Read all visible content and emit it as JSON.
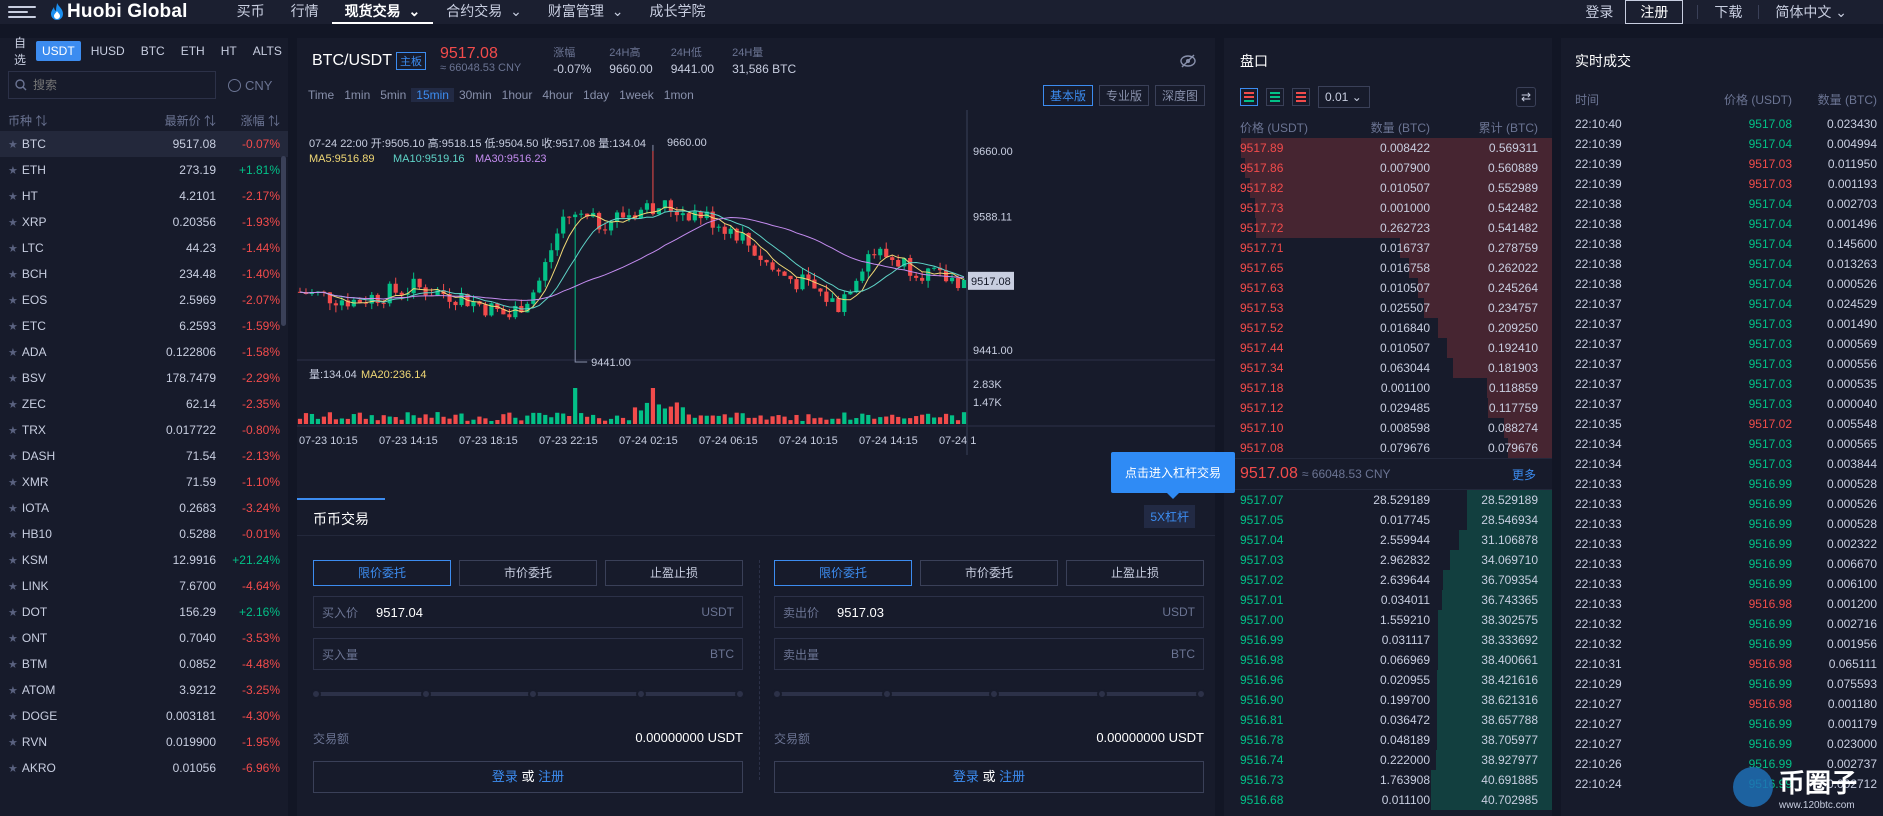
{
  "header": {
    "logo": "Huobi Global",
    "nav": [
      "买币",
      "行情",
      "现货交易",
      "合约交易",
      "财富管理",
      "成长学院"
    ],
    "nav_dropdown": [
      false,
      false,
      true,
      true,
      true,
      false
    ],
    "active_nav": 2,
    "login": "登录",
    "register": "注册",
    "download": "下载",
    "language": "简体中文"
  },
  "left": {
    "tabs": [
      "自选",
      "USDT",
      "HUSD",
      "BTC",
      "ETH",
      "HT",
      "ALTS"
    ],
    "active_tab": 1,
    "search_placeholder": "搜索",
    "currency_toggle": "CNY",
    "columns": [
      "币种",
      "最新价",
      "涨幅"
    ],
    "rows": [
      {
        "sym": "BTC",
        "price": "9517.08",
        "chg": "-0.07%"
      },
      {
        "sym": "ETH",
        "price": "273.19",
        "chg": "+1.81%"
      },
      {
        "sym": "HT",
        "price": "4.2101",
        "chg": "-2.17%"
      },
      {
        "sym": "XRP",
        "price": "0.20356",
        "chg": "-1.93%"
      },
      {
        "sym": "LTC",
        "price": "44.23",
        "chg": "-1.44%"
      },
      {
        "sym": "BCH",
        "price": "234.48",
        "chg": "-1.40%"
      },
      {
        "sym": "EOS",
        "price": "2.5969",
        "chg": "-2.07%"
      },
      {
        "sym": "ETC",
        "price": "6.2593",
        "chg": "-1.59%"
      },
      {
        "sym": "ADA",
        "price": "0.122806",
        "chg": "-1.58%"
      },
      {
        "sym": "BSV",
        "price": "178.7479",
        "chg": "-2.29%"
      },
      {
        "sym": "ZEC",
        "price": "62.14",
        "chg": "-2.35%"
      },
      {
        "sym": "TRX",
        "price": "0.017722",
        "chg": "-0.80%"
      },
      {
        "sym": "DASH",
        "price": "71.54",
        "chg": "-2.13%"
      },
      {
        "sym": "XMR",
        "price": "71.59",
        "chg": "-1.10%"
      },
      {
        "sym": "IOTA",
        "price": "0.2683",
        "chg": "-3.24%"
      },
      {
        "sym": "HB10",
        "price": "0.5288",
        "chg": "-0.01%"
      },
      {
        "sym": "KSM",
        "price": "12.9916",
        "chg": "+21.24%"
      },
      {
        "sym": "LINK",
        "price": "7.6700",
        "chg": "-4.64%"
      },
      {
        "sym": "DOT",
        "price": "156.29",
        "chg": "+2.16%"
      },
      {
        "sym": "ONT",
        "price": "0.7040",
        "chg": "-3.53%"
      },
      {
        "sym": "BTM",
        "price": "0.0852",
        "chg": "-4.48%"
      },
      {
        "sym": "ATOM",
        "price": "3.9212",
        "chg": "-3.25%"
      },
      {
        "sym": "DOGE",
        "price": "0.003181",
        "chg": "-4.30%"
      },
      {
        "sym": "RVN",
        "price": "0.019900",
        "chg": "-1.95%"
      },
      {
        "sym": "AKRO",
        "price": "0.01056",
        "chg": "-6.96%"
      }
    ]
  },
  "ticker": {
    "pair": "BTC/USDT",
    "badge": "主板",
    "price": "9517.08",
    "price_cny": "≈ 66048.53 CNY",
    "change_label": "涨幅",
    "change": "-0.07%",
    "high_label": "24H高",
    "high": "9660.00",
    "low_label": "24H低",
    "low": "9441.00",
    "vol_label": "24H量",
    "vol": "31,586 BTC"
  },
  "chart": {
    "intervals": [
      "Time",
      "1min",
      "5min",
      "15min",
      "30min",
      "1hour",
      "4hour",
      "1day",
      "1week",
      "1mon"
    ],
    "active_interval": 3,
    "views": [
      "基本版",
      "专业版",
      "深度图"
    ],
    "active_view": 0,
    "ohlc": "07-24 22:00  开:9505.10  高:9518.15  低:9504.50  收:9517.08  量:134.04",
    "ma5": "MA5:9516.89",
    "ma10": "MA10:9519.16",
    "ma30": "MA30:9516.23",
    "vol_info": "量:134.04",
    "ma20": "MA20:236.14",
    "y_ticks": [
      "9660.00",
      "9588.11",
      "9441.00"
    ],
    "last_price_tag": "9517.08",
    "high_marker": "9660.00",
    "low_marker": "9441.00",
    "vol_ticks": [
      "2.83K",
      "1.47K"
    ],
    "x_ticks": [
      "07-23 10:15",
      "07-23 14:15",
      "07-23 18:15",
      "07-23 22:15",
      "07-24 02:15",
      "07-24 06:15",
      "07-24 10:15",
      "07-24 14:15",
      "07-24 1"
    ],
    "leverage_tooltip": "点击进入杠杆交易",
    "colors": {
      "up": "#03c087",
      "down": "#f24b4b",
      "ma5": "#f0d875",
      "ma10": "#5fd4c8",
      "ma30": "#c48cf0"
    }
  },
  "trade": {
    "tab": "币币交易",
    "leverage_btn": "5X杠杆",
    "order_types": [
      "限价委托",
      "市价委托",
      "止盈止损"
    ],
    "buy": {
      "price_label": "买入价",
      "price": "9517.04",
      "price_unit": "USDT",
      "qty_label": "买入量",
      "qty_unit": "BTC"
    },
    "sell": {
      "price_label": "卖出价",
      "price": "9517.03",
      "price_unit": "USDT",
      "qty_label": "卖出量",
      "qty_unit": "BTC"
    },
    "amount_label": "交易额",
    "amount": "0.00000000 USDT",
    "login": "登录",
    "or": "或",
    "register": "注册"
  },
  "orderbook": {
    "title": "盘口",
    "precision": "0.01",
    "columns": [
      "价格 (USDT)",
      "数量 (BTC)",
      "累计 (BTC)"
    ],
    "asks": [
      [
        "9517.89",
        "0.008422",
        "0.569311"
      ],
      [
        "9517.86",
        "0.007900",
        "0.560889"
      ],
      [
        "9517.82",
        "0.010507",
        "0.552989"
      ],
      [
        "9517.73",
        "0.001000",
        "0.542482"
      ],
      [
        "9517.72",
        "0.262723",
        "0.541482"
      ],
      [
        "9517.71",
        "0.016737",
        "0.278759"
      ],
      [
        "9517.65",
        "0.016758",
        "0.262022"
      ],
      [
        "9517.63",
        "0.010507",
        "0.245264"
      ],
      [
        "9517.53",
        "0.025507",
        "0.234757"
      ],
      [
        "9517.52",
        "0.016840",
        "0.209250"
      ],
      [
        "9517.44",
        "0.010507",
        "0.192410"
      ],
      [
        "9517.34",
        "0.063044",
        "0.181903"
      ],
      [
        "9517.18",
        "0.001100",
        "0.118859"
      ],
      [
        "9517.12",
        "0.029485",
        "0.117759"
      ],
      [
        "9517.10",
        "0.008598",
        "0.088274"
      ],
      [
        "9517.08",
        "0.079676",
        "0.079676"
      ]
    ],
    "mid_price": "9517.08",
    "mid_cny": "≈ 66048.53 CNY",
    "more": "更多",
    "bids": [
      [
        "9517.07",
        "28.529189",
        "28.529189"
      ],
      [
        "9517.05",
        "0.017745",
        "28.546934"
      ],
      [
        "9517.04",
        "2.559944",
        "31.106878"
      ],
      [
        "9517.03",
        "2.962832",
        "34.069710"
      ],
      [
        "9517.02",
        "2.639644",
        "36.709354"
      ],
      [
        "9517.01",
        "0.034011",
        "36.743365"
      ],
      [
        "9517.00",
        "1.559210",
        "38.302575"
      ],
      [
        "9516.99",
        "0.031117",
        "38.333692"
      ],
      [
        "9516.98",
        "0.066969",
        "38.400661"
      ],
      [
        "9516.96",
        "0.020955",
        "38.421616"
      ],
      [
        "9516.90",
        "0.199700",
        "38.621316"
      ],
      [
        "9516.81",
        "0.036472",
        "38.657788"
      ],
      [
        "9516.78",
        "0.048189",
        "38.705977"
      ],
      [
        "9516.74",
        "0.222000",
        "38.927977"
      ],
      [
        "9516.73",
        "1.763908",
        "40.691885"
      ],
      [
        "9516.68",
        "0.011100",
        "40.702985"
      ]
    ]
  },
  "trades": {
    "title": "实时成交",
    "columns": [
      "时间",
      "价格 (USDT)",
      "数量 (BTC)"
    ],
    "rows": [
      [
        "22:10:40",
        "9517.08",
        "0.023430",
        "up"
      ],
      [
        "22:10:39",
        "9517.04",
        "0.004994",
        "up"
      ],
      [
        "22:10:39",
        "9517.03",
        "0.011950",
        "down"
      ],
      [
        "22:10:39",
        "9517.03",
        "0.001193",
        "down"
      ],
      [
        "22:10:38",
        "9517.04",
        "0.002703",
        "up"
      ],
      [
        "22:10:38",
        "9517.04",
        "0.001496",
        "up"
      ],
      [
        "22:10:38",
        "9517.04",
        "0.145600",
        "up"
      ],
      [
        "22:10:38",
        "9517.04",
        "0.013263",
        "up"
      ],
      [
        "22:10:38",
        "9517.04",
        "0.000526",
        "up"
      ],
      [
        "22:10:37",
        "9517.04",
        "0.024529",
        "up"
      ],
      [
        "22:10:37",
        "9517.03",
        "0.001490",
        "up"
      ],
      [
        "22:10:37",
        "9517.03",
        "0.000569",
        "up"
      ],
      [
        "22:10:37",
        "9517.03",
        "0.000556",
        "up"
      ],
      [
        "22:10:37",
        "9517.03",
        "0.000535",
        "up"
      ],
      [
        "22:10:37",
        "9517.03",
        "0.000040",
        "up"
      ],
      [
        "22:10:35",
        "9517.02",
        "0.005548",
        "down"
      ],
      [
        "22:10:34",
        "9517.03",
        "0.000565",
        "up"
      ],
      [
        "22:10:34",
        "9517.03",
        "0.003844",
        "up"
      ],
      [
        "22:10:33",
        "9516.99",
        "0.000528",
        "up"
      ],
      [
        "22:10:33",
        "9516.99",
        "0.000526",
        "up"
      ],
      [
        "22:10:33",
        "9516.99",
        "0.000528",
        "up"
      ],
      [
        "22:10:33",
        "9516.99",
        "0.002322",
        "up"
      ],
      [
        "22:10:33",
        "9516.99",
        "0.006670",
        "up"
      ],
      [
        "22:10:33",
        "9516.99",
        "0.006100",
        "up"
      ],
      [
        "22:10:33",
        "9516.98",
        "0.001200",
        "down"
      ],
      [
        "22:10:32",
        "9516.99",
        "0.002716",
        "up"
      ],
      [
        "22:10:32",
        "9516.99",
        "0.001956",
        "up"
      ],
      [
        "22:10:31",
        "9516.98",
        "0.065111",
        "down"
      ],
      [
        "22:10:29",
        "9516.99",
        "0.075593",
        "up"
      ],
      [
        "22:10:27",
        "9516.98",
        "0.001180",
        "down"
      ],
      [
        "22:10:27",
        "9516.99",
        "0.001179",
        "up"
      ],
      [
        "22:10:27",
        "9516.99",
        "0.023000",
        "up"
      ],
      [
        "22:10:26",
        "9516.99",
        "0.002737",
        "up"
      ],
      [
        "22:10:24",
        "9516.99",
        "0.002712",
        "up"
      ]
    ]
  },
  "watermark": {
    "name": "币圈子",
    "url": "www.120btc.com"
  }
}
